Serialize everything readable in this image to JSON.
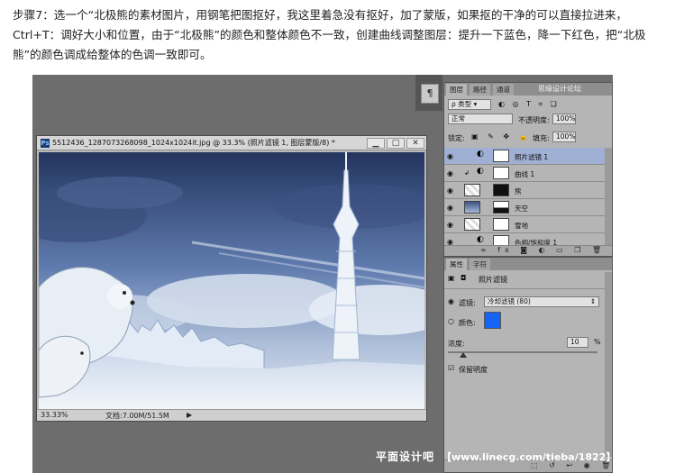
{
  "intro_text": "步骤7：选一个“北极熊的素材图片，用钢笔把图抠好，我这里着急没有抠好，加了蒙版，如果抠的干净的可以直接拉进来，Ctrl+T：调好大小和位置，由于“北极熊”的颜色和整体颜色不一致，创建曲线调整图层：提升一下蓝色，降一下红色，把“北极熊”的颜色调成给整体的色调一致即可。",
  "document": {
    "title": "5512436_1287073268098_1024x1024it.jpg @ 33.3% (照片滤镜 1, 图层蒙版/8) *",
    "zoom": "33.33%",
    "doc_size": "文档:7.00M/51.5M"
  },
  "layers_panel": {
    "tabs": [
      "图层",
      "路径",
      "通道"
    ],
    "filter_kind": "类型",
    "blend_mode": "正常",
    "opacity_label": "不透明度:",
    "opacity_value": "100%",
    "lock_label": "锁定:",
    "fill_label": "填充:",
    "fill_value": "100%",
    "layers": [
      {
        "name": "照片滤镜 1",
        "selected": true
      },
      {
        "name": "曲线 1",
        "selected": false
      },
      {
        "name": "熊",
        "selected": false
      },
      {
        "name": "天空",
        "selected": false
      },
      {
        "name": "雪地",
        "selected": false
      },
      {
        "name": "色相/饱和度 1",
        "selected": false
      }
    ]
  },
  "properties_panel": {
    "tabs": [
      "属性",
      "字符"
    ],
    "adjustment_name": "照片滤镜",
    "filter_label": "滤镜:",
    "filter_value": "冷却滤镜 (80)",
    "color_label": "颜色:",
    "color_hex": "#1564f5",
    "density_label": "浓度:",
    "density_value": "10",
    "density_unit": "%",
    "density_level_percent": 10,
    "preserve_luminosity_label": "保留明度"
  },
  "panel_top_label": "思缘设计论坛",
  "watermark": {
    "site_name": "平面设计吧",
    "url": "【www.linecg.com/tieba/1822】"
  },
  "colors": {
    "workspace": "#6d6d6d",
    "panel": "#b5b5b5",
    "selection": "#9fb0d4",
    "accent": "#1564f5"
  }
}
